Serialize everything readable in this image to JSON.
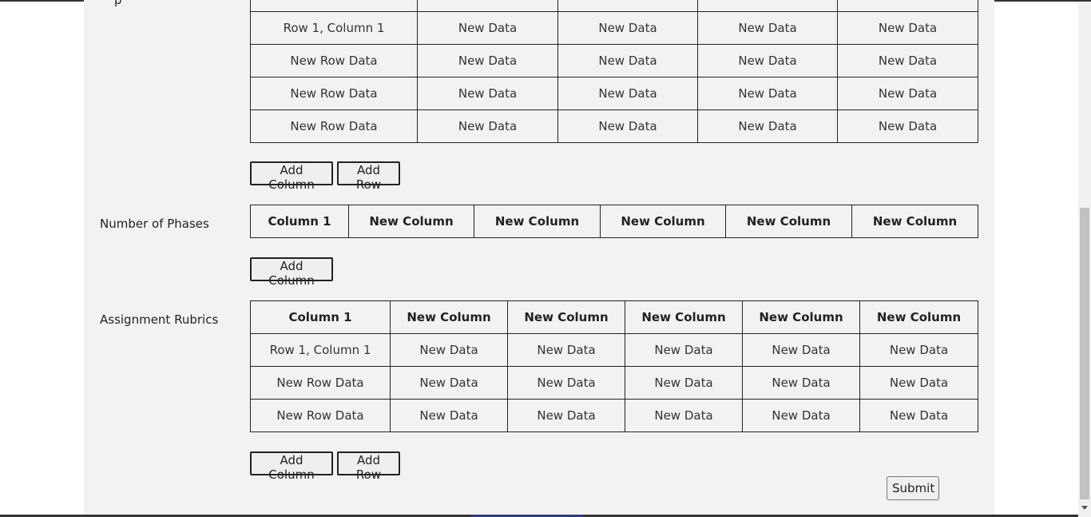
{
  "top_table": {
    "header_row": [
      "",
      "",
      "",
      "",
      ""
    ],
    "rows": [
      [
        "Row 1, Column 1",
        "New Data",
        "New Data",
        "New Data",
        "New Data"
      ],
      [
        "New Row Data",
        "New Data",
        "New Data",
        "New Data",
        "New Data"
      ],
      [
        "New Row Data",
        "New Data",
        "New Data",
        "New Data",
        "New Data"
      ],
      [
        "New Row Data",
        "New Data",
        "New Data",
        "New Data",
        "New Data"
      ]
    ],
    "add_column_label": "Add Column",
    "add_row_label": "Add Row"
  },
  "phases": {
    "label": "Number of Phases",
    "headers": [
      "Column 1",
      "New Column",
      "New Column",
      "New Column",
      "New Column",
      "New Column"
    ],
    "add_column_label": "Add Column"
  },
  "rubrics": {
    "label": "Assignment Rubrics",
    "headers": [
      "Column 1",
      "New Column",
      "New Column",
      "New Column",
      "New Column",
      "New Column"
    ],
    "rows": [
      [
        "Row 1, Column 1",
        "New Data",
        "New Data",
        "New Data",
        "New Data",
        "New Data"
      ],
      [
        "New Row Data",
        "New Data",
        "New Data",
        "New Data",
        "New Data",
        "New Data"
      ],
      [
        "New Row Data",
        "New Data",
        "New Data",
        "New Data",
        "New Data",
        "New Data"
      ]
    ],
    "add_column_label": "Add Column",
    "add_row_label": "Add Row"
  },
  "submit_label": "Submit"
}
